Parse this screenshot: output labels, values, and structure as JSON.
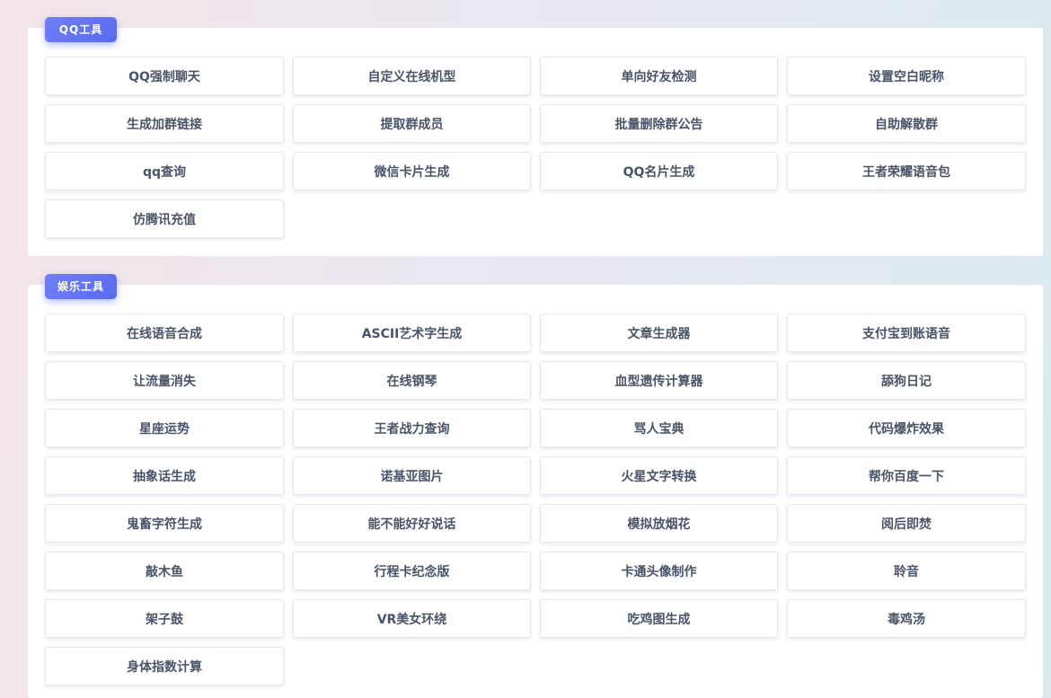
{
  "sections": [
    {
      "title": "QQ工具",
      "items": [
        "QQ强制聊天",
        "自定义在线机型",
        "单向好友检测",
        "设置空白昵称",
        "生成加群链接",
        "提取群成员",
        "批量删除群公告",
        "自助解散群",
        "qq查询",
        "微信卡片生成",
        "QQ名片生成",
        "王者荣耀语音包",
        "仿腾讯充值"
      ]
    },
    {
      "title": "娱乐工具",
      "items": [
        "在线语音合成",
        "ASCII艺术字生成",
        "文章生成器",
        "支付宝到账语音",
        "让流量消失",
        "在线钢琴",
        "血型遗传计算器",
        "舔狗日记",
        "星座运势",
        "王者战力查询",
        "骂人宝典",
        "代码爆炸效果",
        "抽象话生成",
        "诺基亚图片",
        "火星文字转换",
        "帮你百度一下",
        "鬼畜字符生成",
        "能不能好好说话",
        "模拟放烟花",
        "阅后即焚",
        "敲木鱼",
        "行程卡纪念版",
        "卡通头像制作",
        "聆音",
        "架子鼓",
        "VR美女环绕",
        "吃鸡图生成",
        "毒鸡汤",
        "身体指数计算"
      ]
    }
  ]
}
